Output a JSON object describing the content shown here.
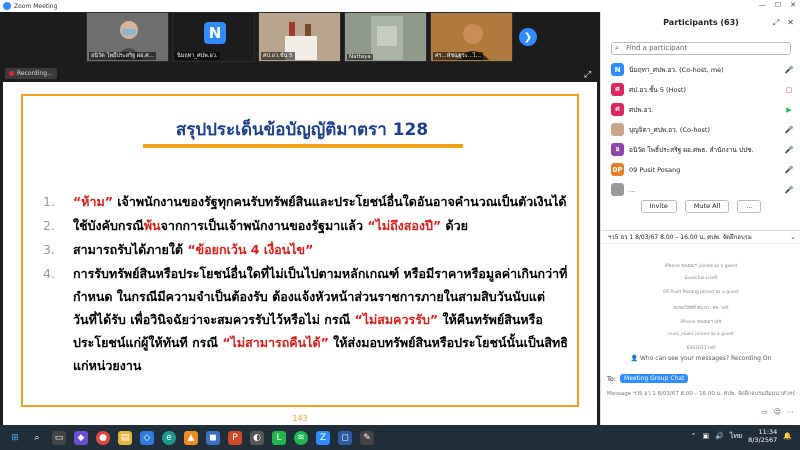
{
  "window": {
    "title": "Zoom Meeting"
  },
  "thumbnails": [
    {
      "name": "อนิวัต โพธิ์ประสริฐ ผอ.ศ..."
    },
    {
      "name": "นิ่มฤทา_ศปพ.อว.",
      "initial": "N"
    },
    {
      "name": "ศป.อว.ชั้น 5"
    },
    {
      "name": "Nattaya"
    },
    {
      "name": "ศร...พัชฌุฐระ...ไ..."
    }
  ],
  "recording": {
    "label": "Recording..."
  },
  "slide": {
    "title": "สรุปประเด็นข้อบัญญัติมาตรา 128",
    "items": [
      {
        "num": "1.",
        "lines": [
          [
            {
              "t": "“ห้าม”",
              "red": true
            },
            {
              "t": " เจ้าพนักงานของรัฐทุกคนรับทรัพย์สินและประโยชน์อื่นใดอันอาจคำนวณเป็นตัวเงินได้"
            }
          ]
        ]
      },
      {
        "num": "2.",
        "lines": [
          [
            {
              "t": "ใช้บังคับกรณี"
            },
            {
              "t": "พ้น",
              "red": true
            },
            {
              "t": "จากการเป็นเจ้าพนักงานของรัฐมาแล้ว "
            },
            {
              "t": "“ไม่ถึงสองปี”",
              "red": true
            },
            {
              "t": " ด้วย"
            }
          ]
        ]
      },
      {
        "num": "3.",
        "lines": [
          [
            {
              "t": "สามารถรับได้ภายใต้ "
            },
            {
              "t": "“ข้อยกเว้น 4 เงื่อนไข”",
              "red": true
            }
          ]
        ]
      },
      {
        "num": "4.",
        "lines": [
          [
            {
              "t": "การรับทรัพย์สินหรือประโยชน์อื่นใดที่ไม่เป็นไปตามหลักเกณฑ์ หรือมีราคาหรือมูลค่าเกินกว่าที่"
            }
          ],
          [
            {
              "t": "กำหนด ในกรณีมีความจำเป็นต้องรับ ต้องแจ้งหัวหน้าส่วนราชการภายในสามสิบวันนับแต่"
            }
          ],
          [
            {
              "t": "วันที่ได้รับ เพื่อวินิจฉัยว่าจะสมควรรับไว้หรือไม่ กรณี "
            },
            {
              "t": "“ไม่สมควรรับ”",
              "red": true
            },
            {
              "t": " ให้คืนทรัพย์สินหรือ"
            }
          ],
          [
            {
              "t": "ประโยชน์แก่ผู้ให้ทันที กรณี "
            },
            {
              "t": "“ไม่สามารถคืนได้”",
              "red": true
            },
            {
              "t": " ให้ส่งมอบทรัพย์สินหรือประโยชน์นั้นเป็นสิทธิ"
            }
          ],
          [
            {
              "t": "แก่หน่วยงาน"
            }
          ]
        ]
      }
    ],
    "page_number": "143"
  },
  "participants": {
    "header": "Participants (63)",
    "search_placeholder": "Find a participant",
    "list": [
      {
        "initial": "N",
        "color": "#2d8cff",
        "name": "นิ่มฤทา_ศปพ.อว. (Co-host, me)"
      },
      {
        "initial": "ศ",
        "color": "#e0245e",
        "name": "ศป.อว.ชั้น 5 (Host)"
      },
      {
        "initial": "ศ",
        "color": "#e0245e",
        "name": "ศปพ.อว."
      },
      {
        "initial": "",
        "color": "#c9a68a",
        "name": "บุญจิตา_ศปพ.อว. (Co-host)"
      },
      {
        "initial": "อ",
        "color": "#8e44ad",
        "name": "อนิวัต โพธิ์ประสริฐ ผอ.ศพธ. สำนักงาน ปปช."
      },
      {
        "initial": "0P",
        "color": "#e67e22",
        "name": "09 Pusit Posang"
      },
      {
        "initial": "",
        "color": "#999999",
        "name": "..."
      }
    ],
    "invite_label": "Invite",
    "muteall_label": "Mute All",
    "more_label": "..."
  },
  "chat": {
    "title": "ฯว5 อว 1 8/03/67 8.00 – 16.00 น. ศปพ. จัดฝึกอบรม",
    "messages": [
      "iPhone ของผมฯ joined as a guest",
      "Suwichai.u.left",
      "09 Pusit Posang joined as a guest",
      "ผมขอให้ดีที่ ศบ.ผว. คพ. left",
      "iPhone ของผมฯ left",
      "nuas_suwis joined as a guest",
      "6062011 left"
    ],
    "who_can_see": "Who can see your messages? Recording On",
    "to_label": "To:",
    "to_value": "Meeting Group Chat",
    "message_placeholder": "Message ฯว5 อว 1 8/03/67 8.00 – 16.00 น. ศปพ. จัดฝึกอบรมสัมมนาหัวหน้า..."
  },
  "taskbar": {
    "time": "11:34",
    "date": "8/3/2567",
    "lang": "ไทย"
  },
  "colors": {
    "zoom_blue": "#2d8cff",
    "accent_orange": "#f4a21a",
    "title_blue": "#1d3f8f",
    "red": "#e11919"
  }
}
